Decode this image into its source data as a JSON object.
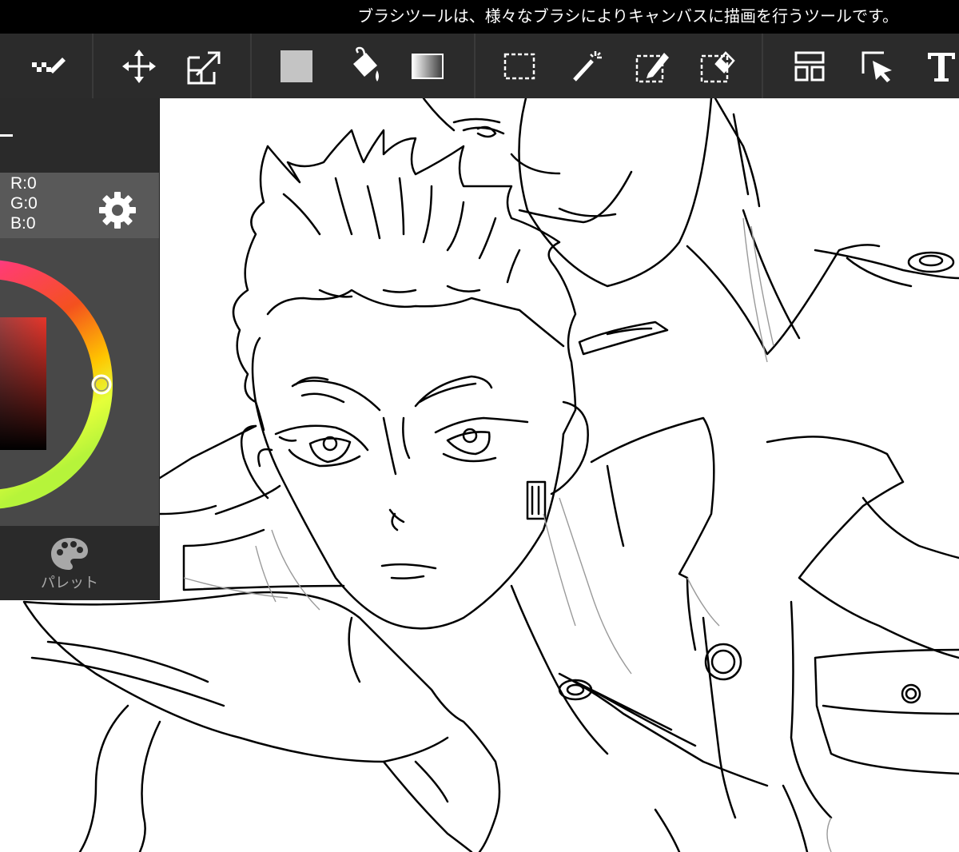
{
  "tooltip": {
    "text": "ブラシツールは、様々なブラシによりキャンバスに描画を行うツールです。"
  },
  "toolbar": {
    "tools": [
      {
        "name": "brush-tool",
        "icon": "brush-stroke-icon"
      },
      {
        "name": "move-tool",
        "icon": "move-arrows-icon"
      },
      {
        "name": "transform-tool",
        "icon": "transform-resize-icon"
      },
      {
        "name": "fill-color-swatch",
        "icon": "color-swatch-icon",
        "color": "#c4c4c4"
      },
      {
        "name": "bucket-tool",
        "icon": "paint-bucket-icon"
      },
      {
        "name": "gradient-tool",
        "icon": "gradient-icon"
      },
      {
        "name": "select-rect-tool",
        "icon": "marquee-select-icon"
      },
      {
        "name": "magic-wand-tool",
        "icon": "magic-wand-icon"
      },
      {
        "name": "select-pen-tool",
        "icon": "selection-pen-icon"
      },
      {
        "name": "select-eraser-tool",
        "icon": "selection-eraser-icon"
      },
      {
        "name": "frame-divider-tool",
        "icon": "frame-layout-icon"
      },
      {
        "name": "operation-tool",
        "icon": "cursor-select-icon"
      },
      {
        "name": "text-tool",
        "icon": "text-t-icon"
      }
    ]
  },
  "color_panel": {
    "rgb": {
      "r": "R:0",
      "g": "G:0",
      "b": "B:0"
    },
    "settings_icon": "gear-icon",
    "hue_ring_colors": [
      "#e040fb",
      "#ff3d6e",
      "#f4511e",
      "#ffc400",
      "#e5ff3a",
      "#b6f43a"
    ],
    "selected_hue_color": "#e8452a",
    "palette": {
      "label": "パレット",
      "icon": "palette-icon"
    }
  },
  "canvas": {
    "background": "#ffffff",
    "content": "line-art-illustration"
  }
}
